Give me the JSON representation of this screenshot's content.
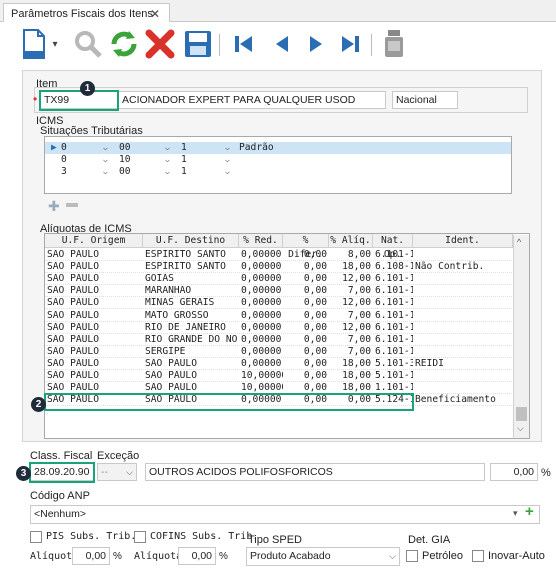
{
  "tab": {
    "title": "Parâmetros Fiscais dos Itens",
    "close": "✕"
  },
  "toolbar": {
    "icons": [
      "new-icon",
      "search-icon",
      "refresh-icon",
      "delete-icon",
      "save-icon",
      "first-icon",
      "prev-icon",
      "next-icon",
      "last-icon",
      "print-icon"
    ]
  },
  "item": {
    "label": "Item",
    "code": "TX99",
    "description": "ACIONADOR EXPERT PARA QUALQUER USOD",
    "origin": "Nacional",
    "marker": "•"
  },
  "icms": {
    "label": "ICMS",
    "situacoes_label": "Situações Tributárias",
    "situacoes_rows": [
      {
        "c1": "0",
        "c2": "00",
        "c3": "1",
        "c4": "Padrão"
      },
      {
        "c1": "0",
        "c2": "10",
        "c3": "1",
        "c4": ""
      },
      {
        "c1": "3",
        "c2": "00",
        "c3": "1",
        "c4": ""
      }
    ],
    "aliquotas_label": "Alíquotas de ICMS",
    "columns": [
      "U.F. Origem",
      "U.F. Destino",
      "% Red.",
      "% Difer.",
      "% Alíq.",
      "Nat. Op.",
      "Ident."
    ],
    "rows": [
      [
        "SÃO PAULO",
        "ESPÍRITO SANTO",
        "0,00000",
        "0,00",
        "8,00",
        "6.101-1",
        ""
      ],
      [
        "SÃO PAULO",
        "ESPÍRITO SANTO",
        "0,00000",
        "0,00",
        "18,00",
        "6.108-1",
        "Não Contrib."
      ],
      [
        "SÃO PAULO",
        "GOIÁS",
        "0,00000",
        "0,00",
        "12,00",
        "6.101-1",
        ""
      ],
      [
        "SÃO PAULO",
        "MARANHÃO",
        "0,00000",
        "0,00",
        "7,00",
        "6.101-1",
        ""
      ],
      [
        "SÃO PAULO",
        "MINAS GERAIS",
        "0,00000",
        "0,00",
        "12,00",
        "6.101-1",
        ""
      ],
      [
        "SÃO PAULO",
        "MATO GROSSO",
        "0,00000",
        "0,00",
        "7,00",
        "6.101-1",
        ""
      ],
      [
        "SÃO PAULO",
        "RIO DE JANEIRO",
        "0,00000",
        "0,00",
        "12,00",
        "6.101-1",
        ""
      ],
      [
        "SÃO PAULO",
        "RIO GRANDE DO NO",
        "0,00000",
        "0,00",
        "7,00",
        "6.101-1",
        ""
      ],
      [
        "SÃO PAULO",
        "SERGIPE",
        "0,00000",
        "0,00",
        "7,00",
        "6.101-1",
        ""
      ],
      [
        "SÃO PAULO",
        "SÃO PAULO",
        "0,00000",
        "0,00",
        "18,00",
        "5.101-3",
        "REIDI"
      ],
      [
        "SÃO PAULO",
        "SÃO PAULO",
        "10,00000",
        "0,00",
        "18,00",
        "5.101-1",
        ""
      ],
      [
        "SÃO PAULO",
        "SÃO PAULO",
        "10,00000",
        "0,00",
        "18,00",
        "1.101-1",
        ""
      ],
      [
        "SÃO PAULO",
        "SÃO PAULO",
        "0,00000",
        "0,00",
        "0,00",
        "5.124-1",
        "Beneficiamento"
      ]
    ]
  },
  "class_fiscal": {
    "label": "Class. Fiscal",
    "excecao_label": "Exceção",
    "value": "28.09.20.90",
    "excecao_value": "--",
    "description": "OUTROS ACIDOS POLIFOSFORICOS",
    "percent": "0,00",
    "percent_unit": "%"
  },
  "codigo_anp": {
    "label": "Código ANP",
    "value": "<Nenhum>"
  },
  "bottom": {
    "pis_label": "PIS Subs. Trib.",
    "cofins_label": "COFINS Subs. Trib.",
    "aliquota_label": "Alíquota",
    "pis_aliquota": "0,00",
    "cofins_aliquota": "0,00",
    "pct": "%",
    "tipo_sped_label": "Tipo SPED",
    "tipo_sped_value": "Produto Acabado",
    "det_gia_label": "Det. GIA",
    "petroleo_label": "Petróleo",
    "inovar_label": "Inovar-Auto"
  },
  "callouts": [
    "1",
    "2",
    "3"
  ],
  "colors": {
    "highlight": "#1aa37a",
    "callout": "#1f2b3a",
    "selected_row": "#cde4f7"
  }
}
